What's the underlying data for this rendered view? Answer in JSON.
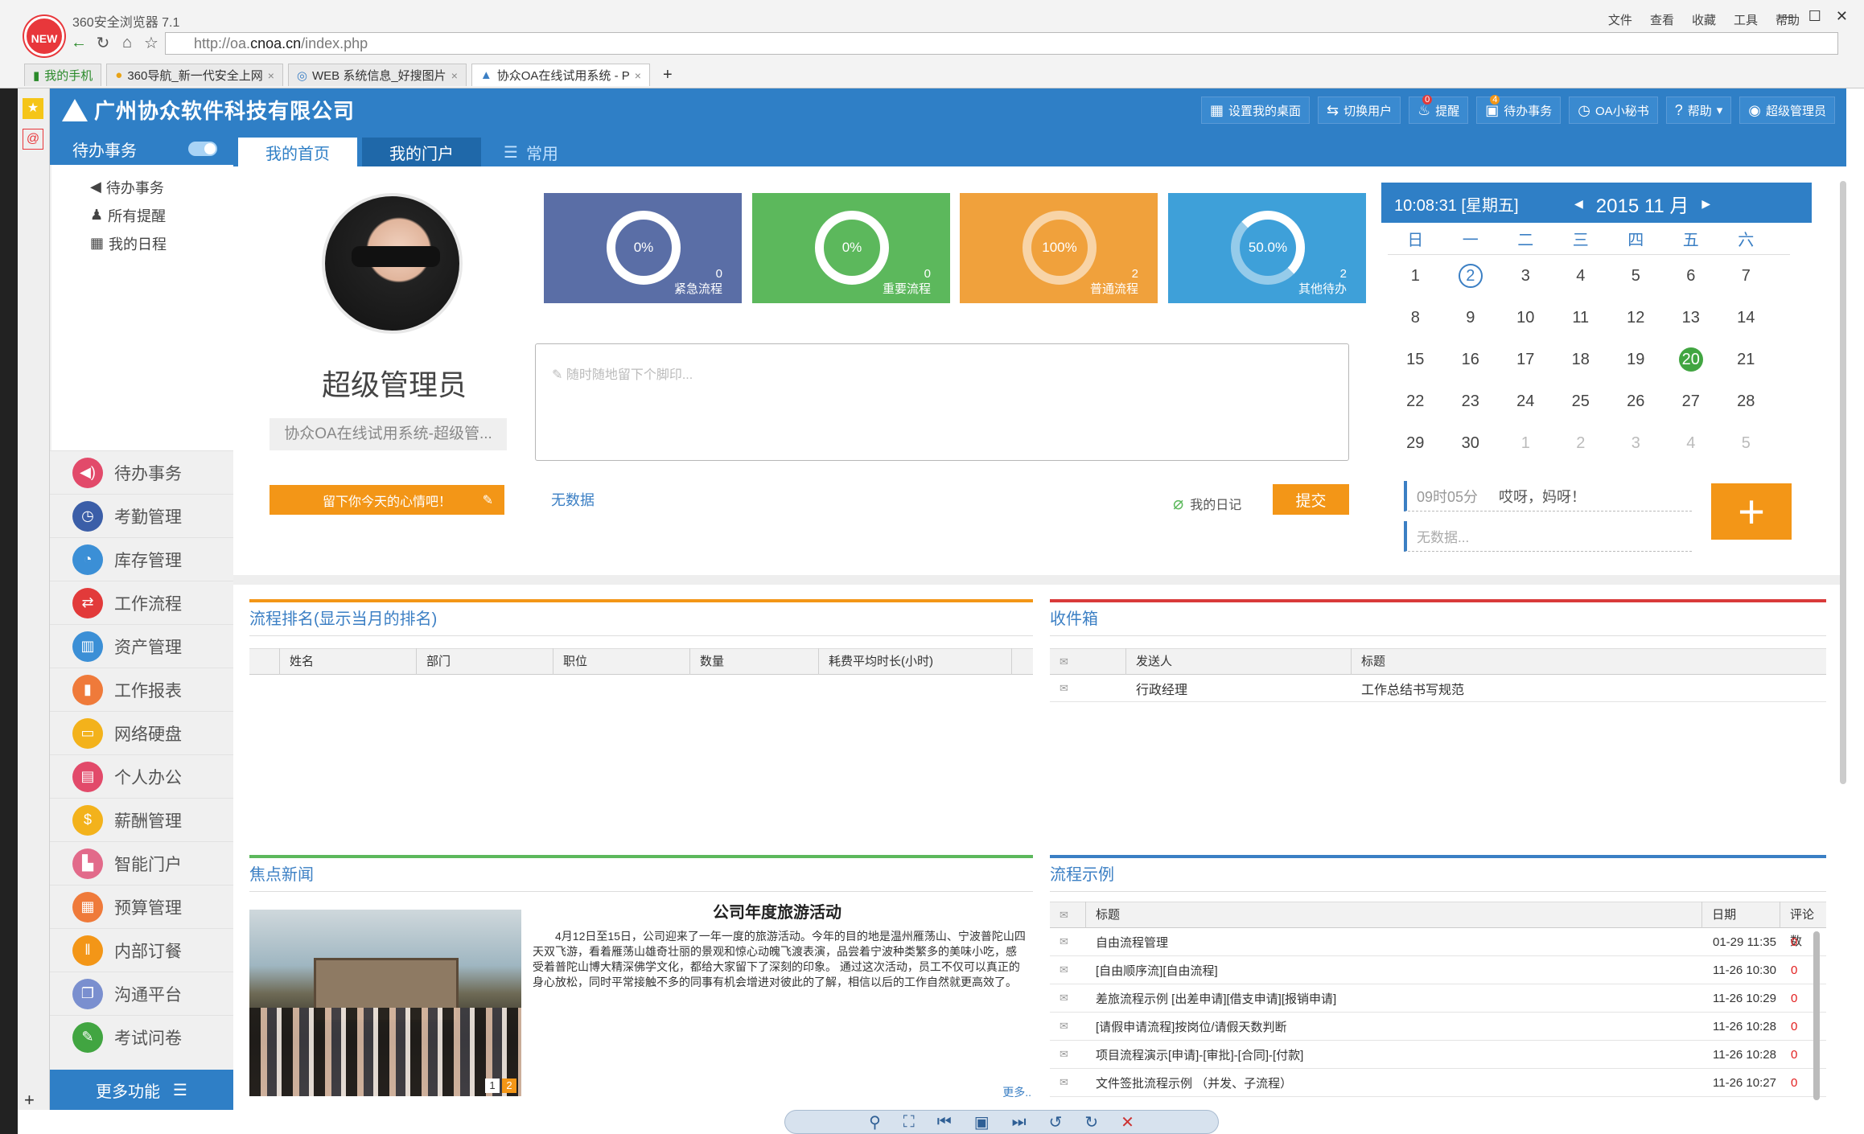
{
  "browser": {
    "logo": "NEW",
    "title": "360安全浏览器 7.1",
    "menu": [
      "文件",
      "查看",
      "收藏",
      "工具",
      "帮助"
    ],
    "url_prefix": "http://oa.",
    "url_domain": "cnoa.cn",
    "url_path": "/index.php",
    "tabs": [
      {
        "label": "我的手机"
      },
      {
        "label": "360导航_新一代安全上网"
      },
      {
        "label": "WEB 系统信息_好搜图片"
      },
      {
        "label": "协众OA在线试用系统 - P"
      }
    ]
  },
  "header": {
    "brand": "广州协众软件科技有限公司",
    "buttons": [
      {
        "label": "设置我的桌面",
        "icon": "grid-icon"
      },
      {
        "label": "切换用户",
        "icon": "switch-user-icon"
      },
      {
        "label": "提醒",
        "icon": "bell-icon",
        "badge": "0"
      },
      {
        "label": "待办事务",
        "icon": "todo-icon",
        "badge": "4"
      },
      {
        "label": "OA小秘书",
        "icon": "clock-icon"
      },
      {
        "label": "帮助",
        "icon": "help-icon"
      },
      {
        "label": "超级管理员",
        "icon": "user-icon"
      }
    ]
  },
  "sidebar": {
    "title": "待办事务",
    "subitems": [
      "待办事务",
      "所有提醒",
      "我的日程"
    ],
    "menu": [
      {
        "label": "待办事务",
        "color": "#e24a6a",
        "icon": "speaker-icon",
        "glyph": "◀)"
      },
      {
        "label": "考勤管理",
        "color": "#3b5ea8",
        "icon": "clock-icon",
        "glyph": "◷"
      },
      {
        "label": "库存管理",
        "color": "#3b8fd6",
        "icon": "pie-icon",
        "glyph": "◔"
      },
      {
        "label": "工作流程",
        "color": "#e23a3a",
        "icon": "flow-icon",
        "glyph": "⇄"
      },
      {
        "label": "资产管理",
        "color": "#3b8fd6",
        "icon": "asset-icon",
        "glyph": "▥"
      },
      {
        "label": "工作报表",
        "color": "#ef7a3a",
        "icon": "chart-icon",
        "glyph": "▮"
      },
      {
        "label": "网络硬盘",
        "color": "#f3b21b",
        "icon": "disk-icon",
        "glyph": "▭"
      },
      {
        "label": "个人办公",
        "color": "#e24a6a",
        "icon": "card-icon",
        "glyph": "▤"
      },
      {
        "label": "薪酬管理",
        "color": "#f3b21b",
        "icon": "money-icon",
        "glyph": "$"
      },
      {
        "label": "智能门户",
        "color": "#e26a8a",
        "icon": "building-icon",
        "glyph": "▙"
      },
      {
        "label": "预算管理",
        "color": "#ef7a3a",
        "icon": "calculator-icon",
        "glyph": "▦"
      },
      {
        "label": "内部订餐",
        "color": "#f39617",
        "icon": "fork-icon",
        "glyph": "ǁ"
      },
      {
        "label": "沟通平台",
        "color": "#7a8fcf",
        "icon": "chat-icon",
        "glyph": "❐"
      },
      {
        "label": "考试问卷",
        "color": "#41a541",
        "icon": "exam-icon",
        "glyph": "✎"
      }
    ],
    "more": "更多功能"
  },
  "tabs": {
    "home": "我的首页",
    "portal": "我的门户",
    "common": "常用"
  },
  "profile": {
    "name": "超级管理员",
    "subtitle": "协众OA在线试用系统-超级管...",
    "mood_button": "留下你今天的心情吧！"
  },
  "stats": [
    {
      "percent": "0%",
      "count": "0",
      "label": "紧急流程",
      "color": "#5a6ea6",
      "level": 0
    },
    {
      "percent": "0%",
      "count": "0",
      "label": "重要流程",
      "color": "#5cb85c",
      "level": 0
    },
    {
      "percent": "100%",
      "count": "2",
      "label": "普通流程",
      "color": "#f0a13c",
      "level": 1
    },
    {
      "percent": "50.0%",
      "count": "2",
      "label": "其他待办",
      "color": "#3ea0d9",
      "level": 0.5
    }
  ],
  "note": {
    "placeholder": "随时随地留下个脚印...",
    "nodata": "无数据",
    "diary": "我的日记",
    "submit": "提交"
  },
  "calendar": {
    "time": "10:08:31 [星期五]",
    "month": "2015 11 月",
    "weekdays": [
      "日",
      "一",
      "二",
      "三",
      "四",
      "五",
      "六"
    ],
    "weeks": [
      [
        "1",
        "2",
        "3",
        "4",
        "5",
        "6",
        "7"
      ],
      [
        "8",
        "9",
        "10",
        "11",
        "12",
        "13",
        "14"
      ],
      [
        "15",
        "16",
        "17",
        "18",
        "19",
        "20",
        "21"
      ],
      [
        "22",
        "23",
        "24",
        "25",
        "26",
        "27",
        "28"
      ],
      [
        "29",
        "30",
        "1",
        "2",
        "3",
        "4",
        "5"
      ]
    ],
    "today": "2",
    "selected": "20",
    "memo_time": "09时05分",
    "memo_text": "哎呀，妈呀！",
    "memo_empty": "无数据..."
  },
  "ranking": {
    "title": "流程排名(显示当月的排名)",
    "columns": [
      "姓名",
      "部门",
      "职位",
      "数量",
      "耗费平均时长(小时)"
    ],
    "bar_color": "#f39617"
  },
  "inbox": {
    "title": "收件箱",
    "columns": [
      "发送人",
      "标题"
    ],
    "rows": [
      {
        "sender": "行政经理",
        "subject": "工作总结书写规范"
      }
    ],
    "bar_color": "#d93a3a"
  },
  "news": {
    "title": "焦点新闻",
    "headline": "公司年度旅游活动",
    "body": "4月12日至15日，公司迎来了一年一度的旅游活动。今年的目的地是温州雁荡山、宁波普陀山四天双飞游，看着雁荡山雄奇壮丽的景观和惊心动魄飞渡表演，品尝着宁波种类繁多的美味小吃，感受着普陀山博大精深佛学文化，都给大家留下了深刻的印象。  通过这次活动，员工不仅可以真正的身心放松，同时平常接触不多的同事有机会增进对彼此的了解，相信以后的工作自然就更高效了。",
    "more": "更多..",
    "pages": [
      "1",
      "2"
    ],
    "bar_color": "#5cb85c"
  },
  "flows": {
    "title": "流程示例",
    "columns": [
      "标题",
      "日期",
      "评论数"
    ],
    "rows": [
      {
        "title": "自由流程管理",
        "date": "01-29 11:35",
        "comments": "0"
      },
      {
        "title": "[自由顺序流][自由流程]",
        "date": "11-26 10:30",
        "comments": "0"
      },
      {
        "title": "差旅流程示例 [出差申请][借支申请][报销申请]",
        "date": "11-26 10:29",
        "comments": "0"
      },
      {
        "title": "[请假申请流程]按岗位/请假天数判断",
        "date": "11-26 10:28",
        "comments": "0"
      },
      {
        "title": "项目流程演示[申请]-[审批]-[合同]-[付款]",
        "date": "11-26 10:28",
        "comments": "0"
      },
      {
        "title": "文件签批流程示例 （并发、子流程）",
        "date": "11-26 10:27",
        "comments": "0"
      }
    ],
    "bar_color": "#3a7fc4"
  }
}
